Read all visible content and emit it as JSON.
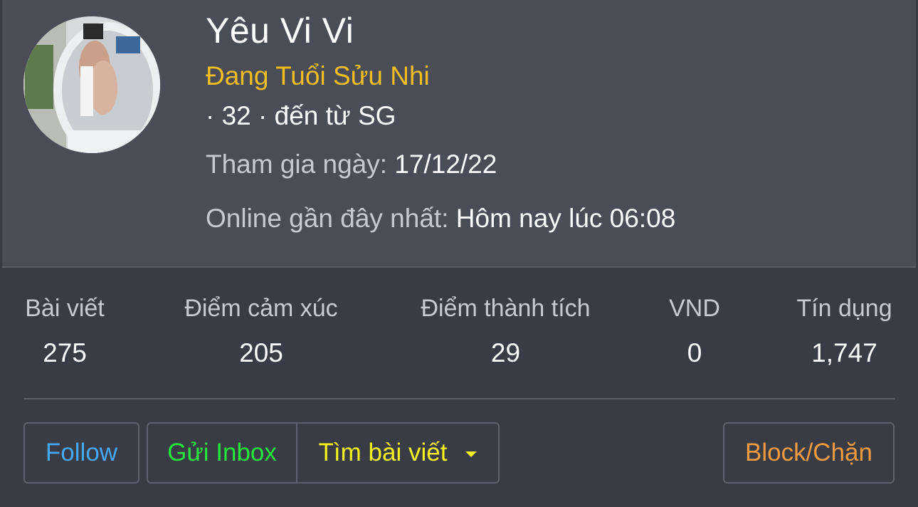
{
  "profile": {
    "username": "Yêu Vi Vi",
    "user_title": "Đang Tuổi Sửu Nhi",
    "meta": "· 32 · đến từ SG",
    "joined_label": "Tham gia ngày:",
    "joined_value": "17/12/22",
    "last_online_label": "Online gần đây nhất:",
    "last_online_value": "Hôm nay lúc 06:08"
  },
  "stats": [
    {
      "label": "Bài viết",
      "value": "275"
    },
    {
      "label": "Điểm cảm xúc",
      "value": "205"
    },
    {
      "label": "Điểm thành tích",
      "value": "29"
    },
    {
      "label": "VND",
      "value": "0"
    },
    {
      "label": "Tín dụng",
      "value": "1,747"
    }
  ],
  "actions": {
    "follow": "Follow",
    "inbox": "Gửi Inbox",
    "find_posts": "Tìm bài viết",
    "block": "Block/Chặn"
  },
  "colors": {
    "background": "#393c45",
    "header_background": "#4a4d56",
    "user_title": "#f2be1f",
    "follow": "#45a8f5",
    "inbox": "#24e83c",
    "find_posts": "#f5f31b",
    "block": "#f29a3f"
  },
  "icons": {
    "find_posts_dropdown": "caret-down-icon"
  }
}
